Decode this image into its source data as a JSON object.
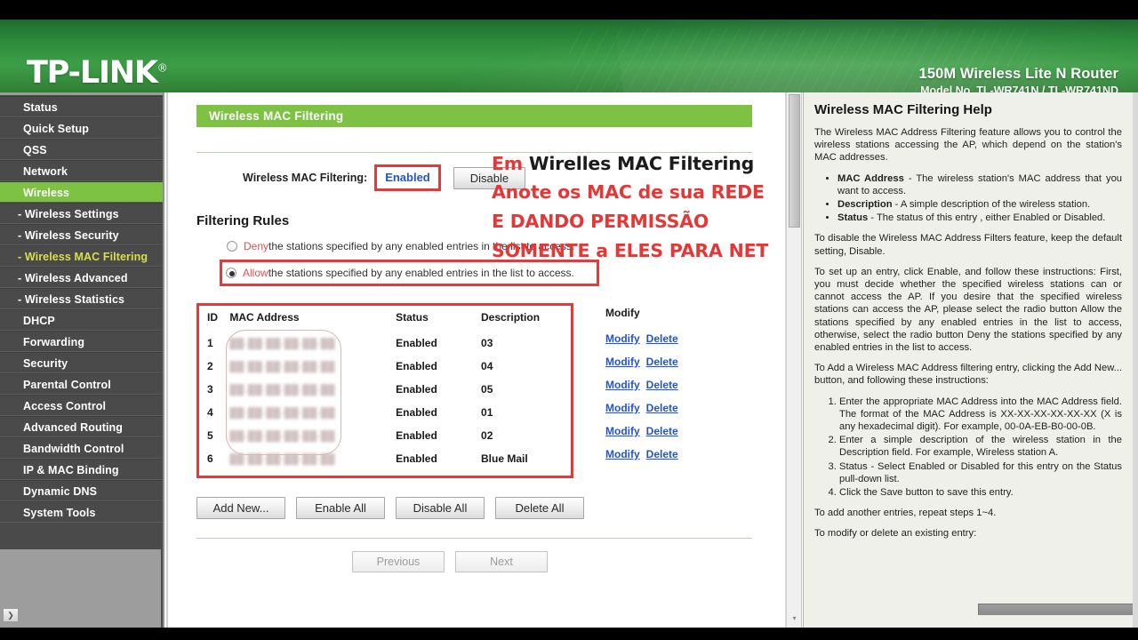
{
  "header": {
    "logo": "TP-LINK",
    "logo_mark": "®",
    "product_title": "150M Wireless Lite N Router",
    "model": "Model No. TL-WR741N / TL-WR741ND"
  },
  "sidebar": {
    "items": [
      {
        "label": "Status",
        "state": "normal"
      },
      {
        "label": "Quick Setup",
        "state": "normal"
      },
      {
        "label": "QSS",
        "state": "normal"
      },
      {
        "label": "Network",
        "state": "normal"
      },
      {
        "label": "Wireless",
        "state": "active-green"
      },
      {
        "label": "- Wireless Settings",
        "state": "sub"
      },
      {
        "label": "- Wireless Security",
        "state": "sub"
      },
      {
        "label": "- Wireless MAC Filtering",
        "state": "sub-active-yellow"
      },
      {
        "label": "- Wireless Advanced",
        "state": "sub"
      },
      {
        "label": "- Wireless Statistics",
        "state": "sub"
      },
      {
        "label": "DHCP",
        "state": "normal"
      },
      {
        "label": "Forwarding",
        "state": "normal"
      },
      {
        "label": "Security",
        "state": "normal"
      },
      {
        "label": "Parental Control",
        "state": "normal"
      },
      {
        "label": "Access Control",
        "state": "normal"
      },
      {
        "label": "Advanced Routing",
        "state": "normal"
      },
      {
        "label": "Bandwidth Control",
        "state": "normal"
      },
      {
        "label": "IP & MAC Binding",
        "state": "normal"
      },
      {
        "label": "Dynamic DNS",
        "state": "normal"
      },
      {
        "label": "System Tools",
        "state": "normal"
      }
    ],
    "scroll_button_glyph": "❯"
  },
  "main": {
    "page_title": "Wireless MAC Filtering",
    "filter_label": "Wireless MAC Filtering:",
    "filter_state_link": "Enabled",
    "disable_button": "Disable",
    "filtering_rules_title": "Filtering Rules",
    "rules": [
      {
        "keyword": "Deny",
        "text": " the stations specified by any enabled entries in the list to access.",
        "selected": false
      },
      {
        "keyword": "Allow",
        "text": " the stations specified by any enabled entries in the list to access.",
        "selected": true
      }
    ],
    "table": {
      "columns": [
        "ID",
        "MAC Address",
        "Status",
        "Description"
      ],
      "modify_column": "Modify",
      "modify_link": "Modify",
      "delete_link": "Delete",
      "rows": [
        {
          "id": "1",
          "mac": "██-██-██-██-██-██",
          "status": "Enabled",
          "description": "03"
        },
        {
          "id": "2",
          "mac": "██-██-██-██-██-██",
          "status": "Enabled",
          "description": "04"
        },
        {
          "id": "3",
          "mac": "██-██-██-██-██-██",
          "status": "Enabled",
          "description": "05"
        },
        {
          "id": "4",
          "mac": "██-██-██-██-██-██",
          "status": "Enabled",
          "description": "01"
        },
        {
          "id": "5",
          "mac": "██-██-██-██-██-██",
          "status": "Enabled",
          "description": "02"
        },
        {
          "id": "6",
          "mac": "██-██-██-██-██-██",
          "status": "Enabled",
          "description": "Blue Mail"
        }
      ]
    },
    "actions": [
      "Add New...",
      "Enable All",
      "Disable All",
      "Delete All"
    ],
    "pager": {
      "previous": "Previous",
      "next": "Next"
    }
  },
  "annotations": [
    {
      "id": "annot1",
      "red_prefix": "Em ",
      "dark_rest": "Wirelles MAC Filtering"
    },
    {
      "id": "annot2",
      "red_prefix": "Anote os MAC de sua REDE",
      "dark_rest": ""
    },
    {
      "id": "annot3",
      "red_prefix": "E DANDO PERMISSÃO",
      "dark_rest": ""
    },
    {
      "id": "annot4",
      "red_prefix": "SOMENTE a ELES PARA NET",
      "dark_rest": ""
    }
  ],
  "help": {
    "title": "Wireless MAC Filtering Help",
    "intro": "The Wireless MAC Address Filtering feature allows you to control the wireless stations accessing the AP, which depend on the station's MAC addresses.",
    "bullets": [
      {
        "term": "MAC Address",
        "text": " - The wireless station's MAC address that you want to access."
      },
      {
        "term": "Description",
        "text": " - A simple description of the wireless station."
      },
      {
        "term": "Status",
        "text": " - The status of this entry , either Enabled or Disabled."
      }
    ],
    "disable_note": "To disable the Wireless MAC Address Filters feature, keep the default setting, Disable.",
    "setup_note": "To set up an entry, click Enable, and follow these instructions: First, you must decide whether the specified wireless stations can or cannot access the AP. If you desire that the specified wireless stations can access the AP, please select the radio button Allow the stations specified by any enabled entries in the list to access, otherwise, select the radio button Deny the stations specified by any enabled entries in the list to access.",
    "add_note": "To Add a Wireless MAC Address filtering entry, clicking the Add New... button, and following these instructions:",
    "steps": [
      "Enter the appropriate MAC Address into the MAC Address field. The format of the MAC Address is XX-XX-XX-XX-XX-XX (X is any hexadecimal digit). For example, 00-0A-EB-B0-00-0B.",
      "Enter a simple description of the wireless station in the Description field. For example, Wireless station A.",
      "Status - Select Enabled or Disabled for this entry on the Status pull-down list.",
      "Click the Save button to save this entry."
    ],
    "repeat_note": "To add another entries, repeat steps 1~4.",
    "cut_note": "To modify or delete an existing entry:"
  },
  "colors": {
    "brand_green": "#7dc243",
    "header_green": "#2d8b3c",
    "sidebar_gray": "#4a4a4a",
    "annotation_red": "#e63737",
    "link_blue": "#2255cc",
    "highlight_yellow": "#d7e04a"
  }
}
